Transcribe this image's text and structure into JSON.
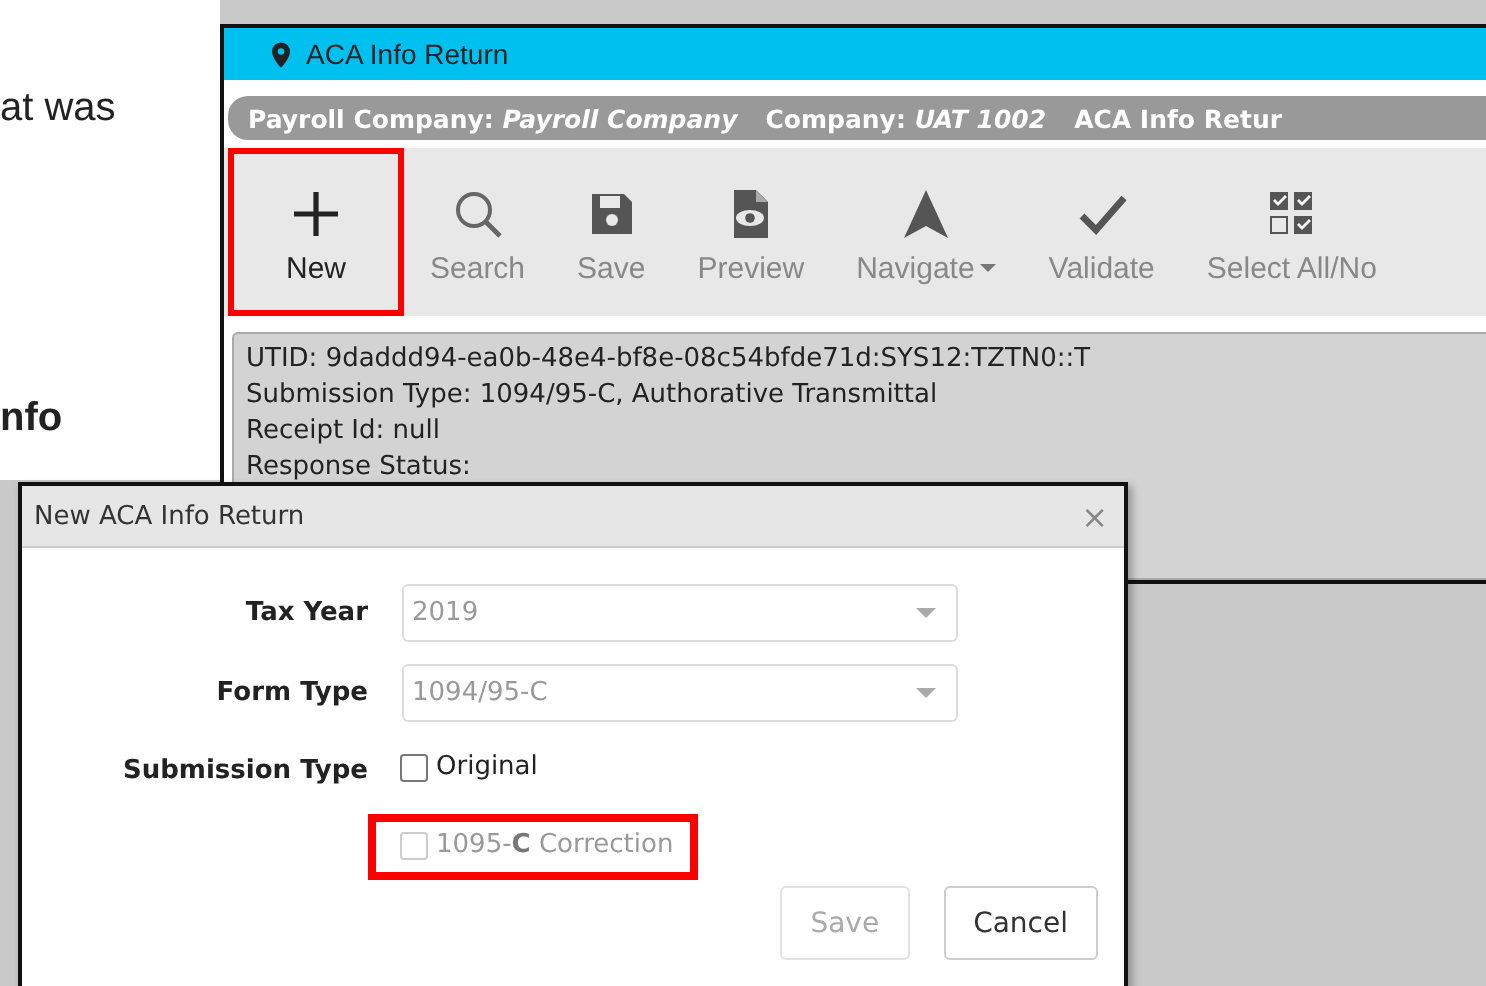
{
  "document_text": [
    {
      "text": "at was",
      "bold": false
    },
    {
      "text": "nfo",
      "bold": true
    }
  ],
  "app_window": {
    "title": "ACA Info Return",
    "breadcrumb": [
      {
        "label": "Payroll Company:",
        "value": "Payroll Company"
      },
      {
        "label": "Company:",
        "value": "UAT 1002"
      },
      {
        "label": "ACA Info Retur"
      }
    ],
    "toolbar": [
      {
        "label": "New",
        "kind": "plus",
        "highlighted": true,
        "dropdown": false
      },
      {
        "label": "Search",
        "kind": "search",
        "highlighted": false,
        "dropdown": false
      },
      {
        "label": "Save",
        "kind": "save",
        "highlighted": false,
        "dropdown": false
      },
      {
        "label": "Preview",
        "kind": "preview",
        "highlighted": false,
        "dropdown": false
      },
      {
        "label": "Navigate",
        "kind": "navigate",
        "highlighted": false,
        "dropdown": true
      },
      {
        "label": "Validate",
        "kind": "validate",
        "highlighted": false,
        "dropdown": false
      },
      {
        "label": "Select All/No",
        "kind": "select-all",
        "highlighted": false,
        "dropdown": false
      }
    ],
    "info_lines": [
      "UTID: 9daddd94-ea0b-48e4-bf8e-08c54bfde71d:SYS12:TZTN0::T",
      "Submission Type: 1094/95-C, Authorative Transmittal",
      "Receipt Id: null",
      "Response Status:"
    ]
  },
  "dialog": {
    "title": "New ACA Info Return",
    "close": "×",
    "fields": [
      {
        "label": "Tax Year",
        "value": "2019"
      },
      {
        "label": "Form Type",
        "value": "1094/95-C"
      }
    ],
    "submission_type": {
      "label": "Submission Type",
      "options": [
        {
          "label": "Original",
          "checked": false,
          "disabled": false,
          "highlighted": false
        },
        {
          "label": "1095-**C** Correction",
          "checked": false,
          "disabled": true,
          "highlighted": true
        }
      ]
    },
    "buttons": [
      {
        "label": "Save",
        "disabled": true
      },
      {
        "label": "Cancel",
        "disabled": false
      }
    ]
  }
}
